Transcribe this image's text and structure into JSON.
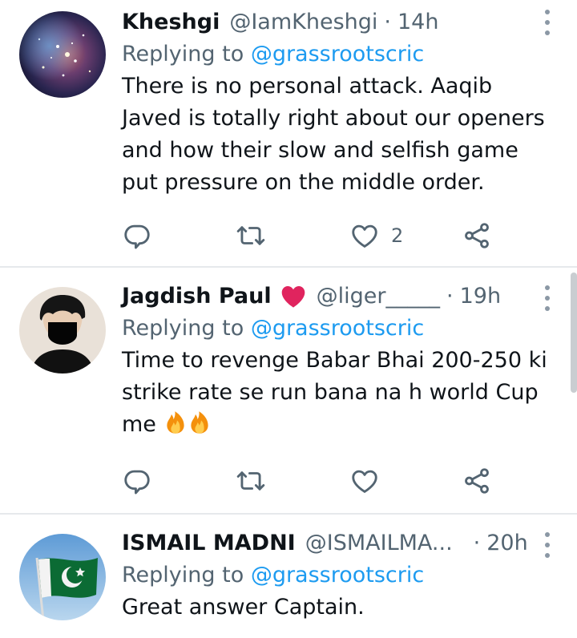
{
  "tweets": [
    {
      "name": "Kheshgi",
      "handle": "@IamKheshgi",
      "time": "14h",
      "replying_prefix": "Replying to",
      "replying_to": "@grassrootscric",
      "text": "There is no personal attack. Aaqib Javed is totally right about our openers and how their slow and selfish game put pressure on the middle order.",
      "like_count": "2",
      "avatar": "space-nebula-avatar"
    },
    {
      "name": "Jagdish Paul",
      "name_emoji": "red-heart-emoji",
      "handle": "@liger_____",
      "time": "19h",
      "replying_prefix": "Replying to",
      "replying_to": "@grassrootscric",
      "text": "Time to revenge Babar Bhai 200-250 ki strike rate se run bana na h world Cup me",
      "text_emoji": [
        "fire-emoji",
        "fire-emoji"
      ],
      "like_count": "",
      "avatar": "masked-person-avatar"
    },
    {
      "name": "ISMAIL MADNI",
      "handle": "@ISMAILMA...",
      "time": "20h",
      "replying_prefix": "Replying to",
      "replying_to": "@grassrootscric",
      "text": "Great answer Captain.",
      "avatar": "pakistan-flag-avatar"
    }
  ],
  "separator": "·",
  "colors": {
    "accent": "#1d9bf0",
    "secondary_text": "#536471",
    "primary_text": "#0f1419",
    "heart_red": "#e0245e"
  }
}
